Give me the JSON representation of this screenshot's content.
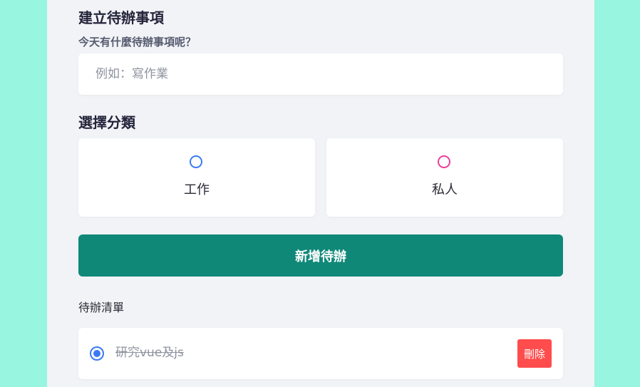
{
  "form": {
    "title": "建立待辦事項",
    "prompt": "今天有什麼待辦事項呢？",
    "input_value": "",
    "input_placeholder": "例如：寫作業"
  },
  "category": {
    "title": "選擇分類",
    "options": [
      {
        "label": "工作",
        "selected": false,
        "color": "#3b7bf0"
      },
      {
        "label": "私人",
        "selected": false,
        "color": "#e8409a"
      }
    ]
  },
  "add_button": {
    "label": "新增待辦",
    "color": "#108878"
  },
  "todo_list": {
    "heading": "待辦清單",
    "items": [
      {
        "text": "研究vue及js",
        "done": true,
        "category_color": "#3b7bf0",
        "delete_label": "刪除"
      }
    ],
    "delete_color": "#ff4c4c"
  },
  "colors": {
    "background": "#98f5e0",
    "panel": "#f1f3f7"
  }
}
